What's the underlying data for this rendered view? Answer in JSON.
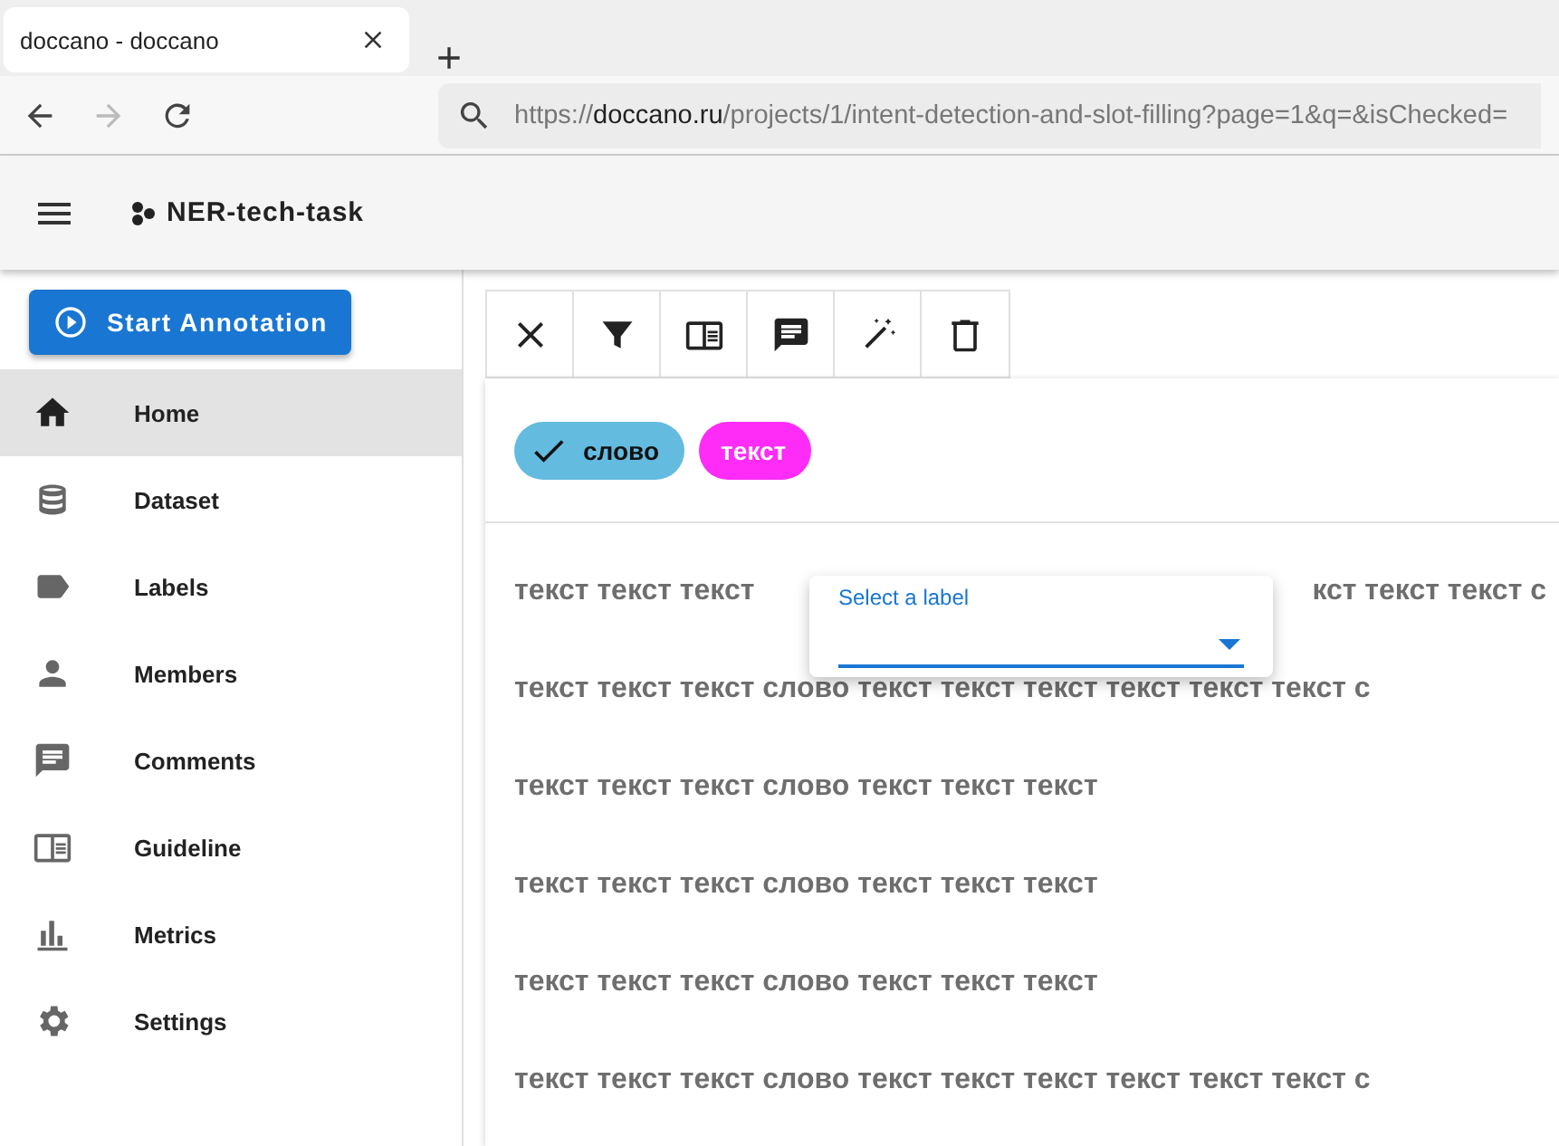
{
  "browser": {
    "tab_title": "doccano - doccano",
    "url_prefix": "https://",
    "url_host": "doccano.ru",
    "url_path": "/projects/1/intent-detection-and-slot-filling?page=1&q=&isChecked="
  },
  "app_bar": {
    "title": "NER-tech-task"
  },
  "sidebar": {
    "start_button": "Start Annotation",
    "items": [
      {
        "label": "Home",
        "kind": "home",
        "selected": true
      },
      {
        "label": "Dataset",
        "kind": "database",
        "selected": false
      },
      {
        "label": "Labels",
        "kind": "label",
        "selected": false
      },
      {
        "label": "Members",
        "kind": "person",
        "selected": false
      },
      {
        "label": "Comments",
        "kind": "comment",
        "selected": false
      },
      {
        "label": "Guideline",
        "kind": "guide",
        "selected": false
      },
      {
        "label": "Metrics",
        "kind": "chart",
        "selected": false
      },
      {
        "label": "Settings",
        "kind": "gear",
        "selected": false
      }
    ]
  },
  "toolbar": [
    {
      "kind": "close"
    },
    {
      "kind": "filter"
    },
    {
      "kind": "guide"
    },
    {
      "kind": "comment"
    },
    {
      "kind": "wand"
    },
    {
      "kind": "trash"
    }
  ],
  "labels": [
    {
      "text": "слово",
      "color": "#64bbe0",
      "checked": true
    },
    {
      "text": "текст",
      "color": "#ff2bf6",
      "checked": false
    }
  ],
  "label_menu": {
    "label": "Select a label"
  },
  "lines": [
    {
      "kind": "covered",
      "before": "текст текст текст",
      "after": "кст текст текст с"
    },
    {
      "kind": "plain",
      "text": "текст текст текст слово текст текст текст текст текст текст с"
    },
    {
      "kind": "plain",
      "text": "текст текст текст слово текст текст текст"
    },
    {
      "kind": "plain",
      "text": "текст текст текст слово текст текст текст"
    },
    {
      "kind": "plain",
      "text": "текст текст текст слово текст текст текст"
    },
    {
      "kind": "plain",
      "text": "текст текст текст слово текст текст текст текст текст текст с"
    }
  ]
}
